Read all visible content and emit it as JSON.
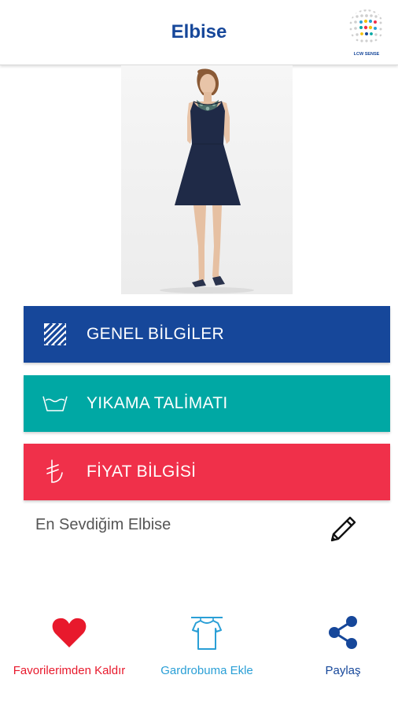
{
  "header": {
    "title": "Elbise",
    "logo_text": "LCW SENSE"
  },
  "product_image": {
    "icon": "dress-photo"
  },
  "sections": [
    {
      "label": "GENEL BİLGİLER",
      "icon": "stripes-icon",
      "color": "#16479a"
    },
    {
      "label": "YIKAMA TALİMATI",
      "icon": "wash-icon",
      "color": "#00a8a4"
    },
    {
      "label": "FİYAT BİLGİSİ",
      "icon": "lira-icon",
      "color": "#f0304a"
    }
  ],
  "favorite_name": "En Sevdiğim Elbise",
  "bottom_bar": {
    "remove_favorite": {
      "label": "Favorilerimden Kaldır",
      "color": "#e8192c"
    },
    "add_wardrobe": {
      "label": "Gardrobuma Ekle",
      "color": "#2a9fd6"
    },
    "share": {
      "label": "Paylaş",
      "color": "#16479a"
    }
  }
}
